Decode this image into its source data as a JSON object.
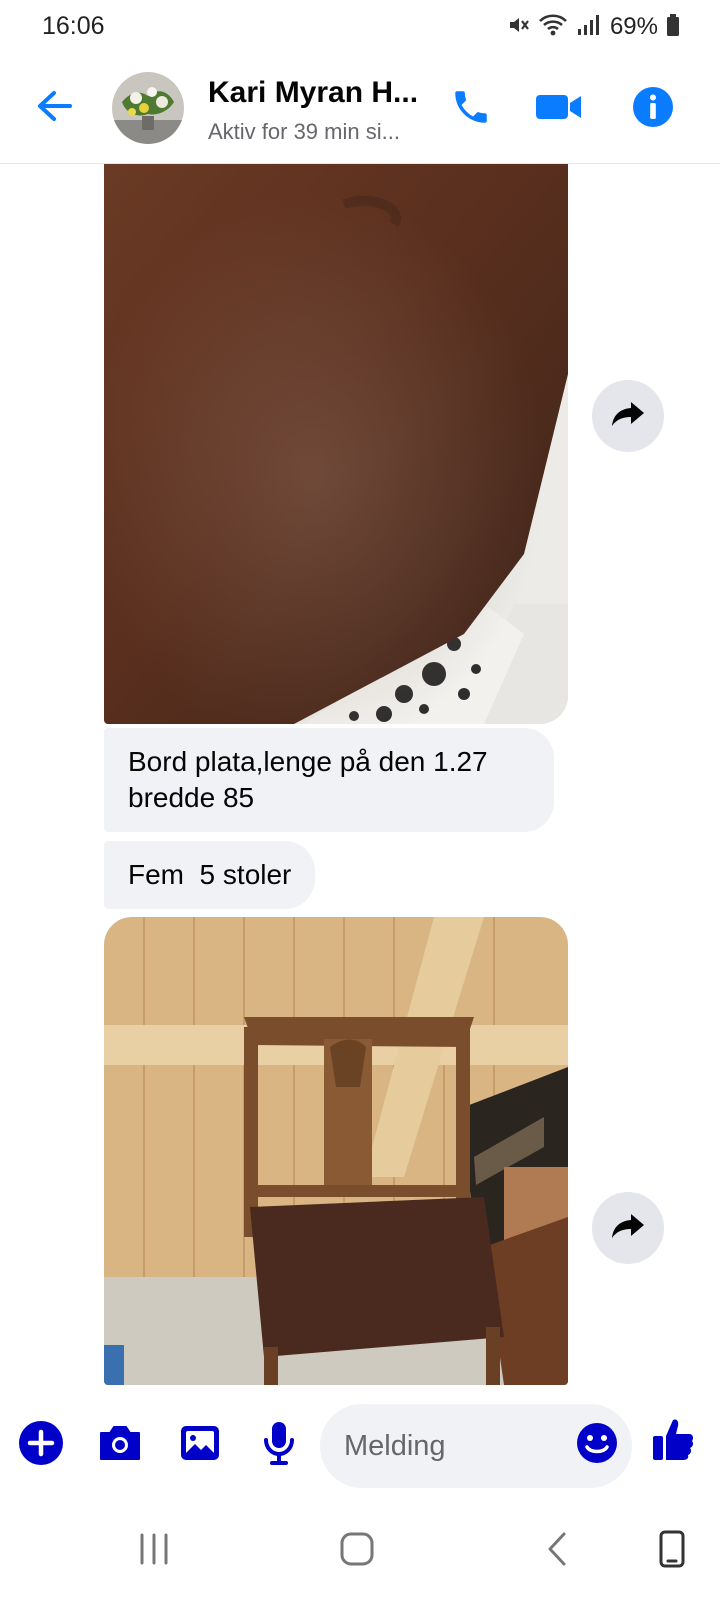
{
  "status_bar": {
    "time": "16:06",
    "battery": "69%",
    "icons": [
      "mute-icon",
      "wifi-icon",
      "signal-icon",
      "battery-icon"
    ]
  },
  "header": {
    "contact_name": "Kari Myran H...",
    "contact_status": "Aktiv for 39 min si...",
    "icons": [
      "back-arrow-icon",
      "phone-icon",
      "video-camera-icon",
      "info-icon"
    ]
  },
  "messages": [
    {
      "type": "image",
      "subject": "table-top-photo"
    },
    {
      "type": "text",
      "text_line1": "Bord plata,lenge på den 1.27",
      "text_line2": "bredde 85"
    },
    {
      "type": "text",
      "text": "Fem  5 stoler"
    },
    {
      "type": "image",
      "subject": "chair-photo"
    }
  ],
  "composer": {
    "placeholder": "Melding",
    "icons": [
      "plus-icon",
      "camera-icon",
      "gallery-icon",
      "microphone-icon",
      "emoji-icon",
      "thumbs-up-icon"
    ]
  },
  "nav_bar": {
    "icons": [
      "recent-apps-icon",
      "home-icon",
      "back-icon",
      "rotate-icon"
    ]
  },
  "colors": {
    "accent": "#0a7cff",
    "composer_accent": "#0000c8",
    "bubble": "#f0f2f5",
    "secondary_text": "#65676b"
  }
}
